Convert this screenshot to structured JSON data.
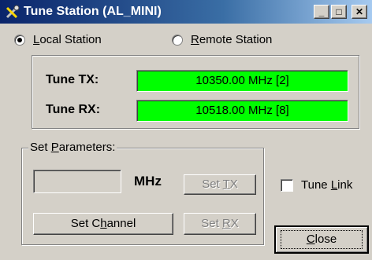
{
  "window": {
    "title": "Tune Station (AL_MINI)",
    "controls": {
      "minimize": "_",
      "maximize": "□",
      "close": "✕"
    }
  },
  "station": {
    "local_prefix": "",
    "local_hot": "L",
    "local_rest": "ocal Station",
    "remote_hot": "R",
    "remote_rest": "emote Station",
    "selected": "local"
  },
  "tune": {
    "tx_label": "Tune TX:",
    "tx_value": "10350.00 MHz  [2]",
    "rx_label": "Tune RX:",
    "rx_value": "10518.00 MHz  [8]",
    "meter_color": "#00ff00"
  },
  "set_parameters": {
    "legend_pre": "Set ",
    "legend_hot": "P",
    "legend_post": "arameters:",
    "freq_input_value": "",
    "unit": "MHz",
    "set_tx_pre": "Set ",
    "set_tx_hot": "T",
    "set_tx_post": "X",
    "set_rx_pre": "Set ",
    "set_rx_hot": "R",
    "set_rx_post": "X",
    "set_channel_pre": "Set C",
    "set_channel_hot": "h",
    "set_channel_post": "annel"
  },
  "tune_link": {
    "pre": "Tune ",
    "hot": "L",
    "post": "ink",
    "checked": false
  },
  "close": {
    "hot": "C",
    "post": "lose"
  }
}
